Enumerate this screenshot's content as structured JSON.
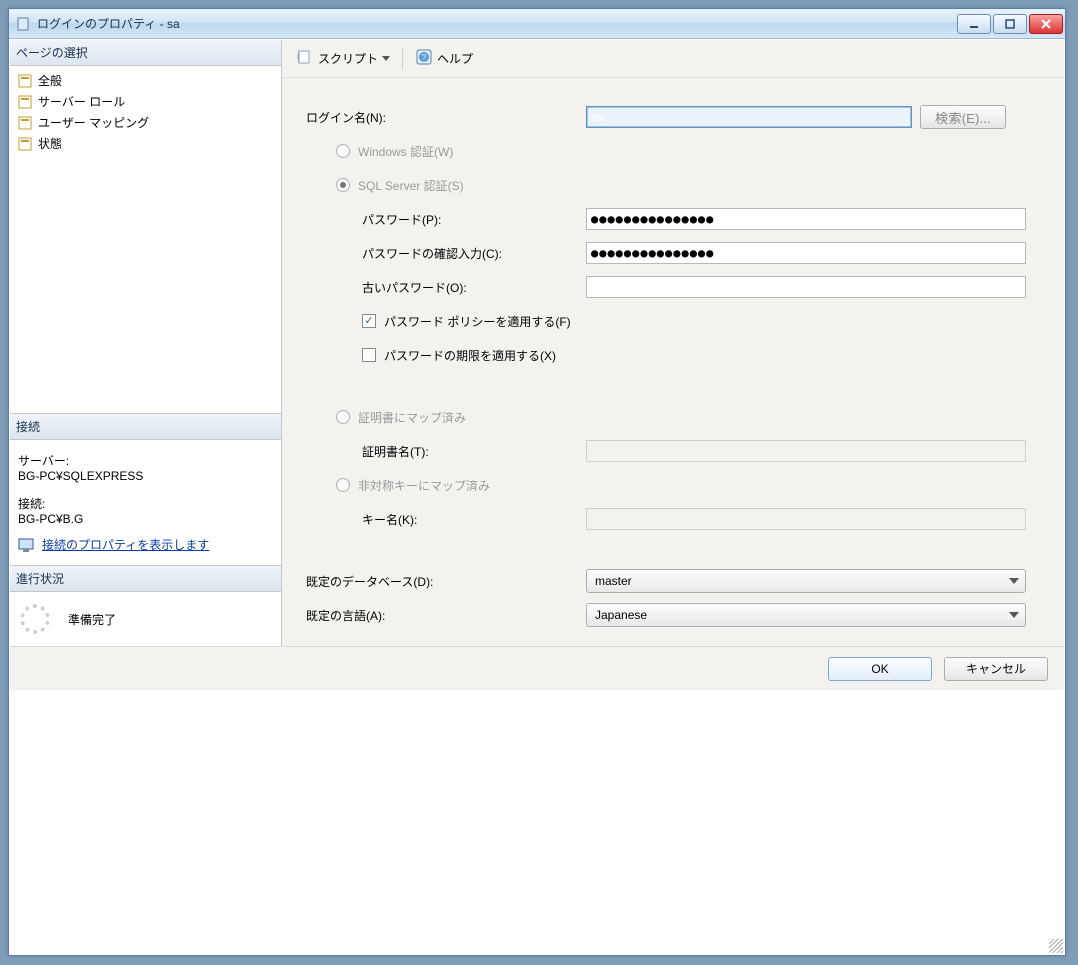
{
  "window": {
    "title": "ログインのプロパティ - sa"
  },
  "sidebar": {
    "pageSelectHeader": "ページの選択",
    "items": [
      {
        "label": "全般"
      },
      {
        "label": "サーバー ロール"
      },
      {
        "label": "ユーザー マッピング"
      },
      {
        "label": "状態"
      }
    ],
    "connection": {
      "header": "接続",
      "serverLabel": "サーバー:",
      "serverValue": "BG-PC¥SQLEXPRESS",
      "connLabel": "接続:",
      "connValue": "BG-PC¥B.G",
      "propsLink": "接続のプロパティを表示します"
    },
    "progress": {
      "header": "進行状況",
      "status": "準備完了"
    }
  },
  "toolbar": {
    "script": "スクリプト",
    "help": "ヘルプ"
  },
  "form": {
    "loginNameLabel": "ログイン名(N):",
    "loginNameValue": "sa",
    "searchBtn": "検索(E)...",
    "winAuth": "Windows 認証(W)",
    "sqlAuth": "SQL Server 認証(S)",
    "passwordLabel": "パスワード(P):",
    "passwordValue": "●●●●●●●●●●●●●●●",
    "confirmLabel": "パスワードの確認入力(C):",
    "confirmValue": "●●●●●●●●●●●●●●●",
    "oldPasswordLabel": "古いパスワード(O):",
    "enforcePolicy": "パスワード ポリシーを適用する(F)",
    "enforceExpiry": "パスワードの期限を適用する(X)",
    "mappedCert": "証明書にマップ済み",
    "certNameLabel": "証明書名(T):",
    "mappedAsym": "非対称キーにマップ済み",
    "keyNameLabel": "キー名(K):",
    "defaultDbLabel": "既定のデータベース(D):",
    "defaultDbValue": "master",
    "defaultLangLabel": "既定の言語(A):",
    "defaultLangValue": "Japanese"
  },
  "footer": {
    "ok": "OK",
    "cancel": "キャンセル"
  }
}
